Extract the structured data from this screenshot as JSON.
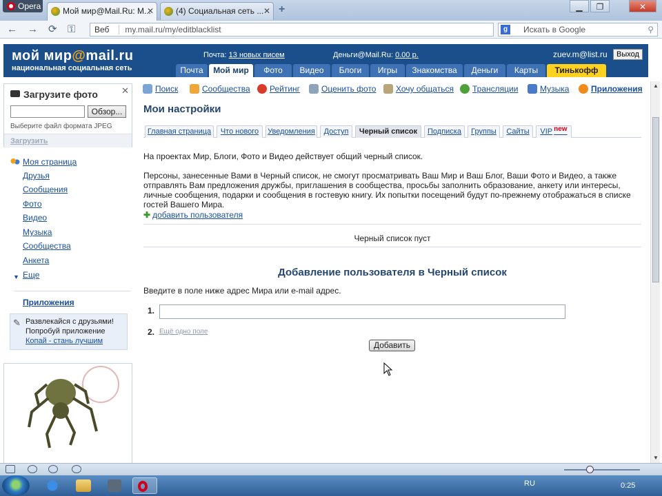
{
  "browser": {
    "opera_label": "Opera",
    "tabs": [
      {
        "title": "Мой мир@Mail.Ru: М..."
      },
      {
        "title": "(4) Социальная сеть ..."
      }
    ],
    "back": "←",
    "forward": "→",
    "reload": "⟳",
    "key": "⚿",
    "address": {
      "prefix": "Веб",
      "url_domain": "my.mail.ru",
      "url_path": "/my/editblacklist"
    },
    "search_placeholder": "Искать в Google",
    "win_min": "▁",
    "win_max": "❐",
    "win_close": "✕"
  },
  "header": {
    "logo_main": "мой мир",
    "logo_at": "@",
    "logo_brand": "mail.ru",
    "logo_sub": "национальная социальная сеть",
    "mail_label": "Почта:",
    "mail_link": "13 новых писем",
    "money_label": "Деньги@Mail.Ru:",
    "money_link": "0.00 р.",
    "user_email": "zuev.m@list.ru",
    "exit": "Выход",
    "tabs": [
      "Почта",
      "Мой мир",
      "Фото",
      "Видео",
      "Блоги",
      "Игры",
      "Знакомства",
      "Деньги",
      "Карты",
      "Тинькофф"
    ]
  },
  "upload": {
    "title": "Загрузите фото",
    "close": "✕",
    "browse": "Обзор...",
    "hint": "Выберите файл формата JPEG",
    "submit": "Загрузить"
  },
  "leftnav": {
    "my_page": "Моя страница",
    "items": [
      "Друзья",
      "Сообщения",
      "Фото",
      "Видео",
      "Музыка",
      "Сообщества",
      "Анкета"
    ],
    "more": "Еще",
    "apps": "Приложения",
    "promo": {
      "line1": "Развлекайся с друзьями!",
      "line2": "Попробуй приложение",
      "link": "Копай - стань лучшим"
    }
  },
  "subnav": [
    "Поиск",
    "Сообщества",
    "Рейтинг",
    "Оценить фото",
    "Хочу общаться",
    "Трансляции",
    "Музыка",
    "Приложения"
  ],
  "page_title": "Мои настройки",
  "settings_tabs": [
    "Главная страница",
    "Что нового",
    "Уведомления",
    "Доступ",
    "Черный список",
    "Подписка",
    "Группы",
    "Сайты",
    "VIP"
  ],
  "vip_badge": "new",
  "content": {
    "p1": "На проектах Мир, Блоги, Фото и Видео действует общий черный список.",
    "p2": "Персоны, занесенные Вами в Черный список, не смогут просматривать Ваш Мир и Ваш Блог, Ваши Фото и Видео, а также отправлять Вам предложения дружбы, приглашения в сообщества, просьбы заполнить образование, анкету или интересы, личные сообщения, подарки и сообщения в гостевую книгу. Их попытки посещений будут по-прежнему отображаться в списке гостей Вашего Мира.",
    "add_user": "добавить пользователя",
    "empty": "Черный список пуст",
    "form_title": "Добавление пользователя в Черный список",
    "instruction": "Введите в поле ниже адрес Мира или e-mail адрес.",
    "row1": "1.",
    "row2": "2.",
    "another": "Ещё одно поле",
    "add_button": "Добавить"
  },
  "taskbar": {
    "lang": "RU",
    "time": "0:25"
  },
  "colors": {
    "header_bg": "#1a4f8c",
    "tinkoff": "#ffd21f",
    "link": "#1a4fa0",
    "title": "#24466f"
  }
}
